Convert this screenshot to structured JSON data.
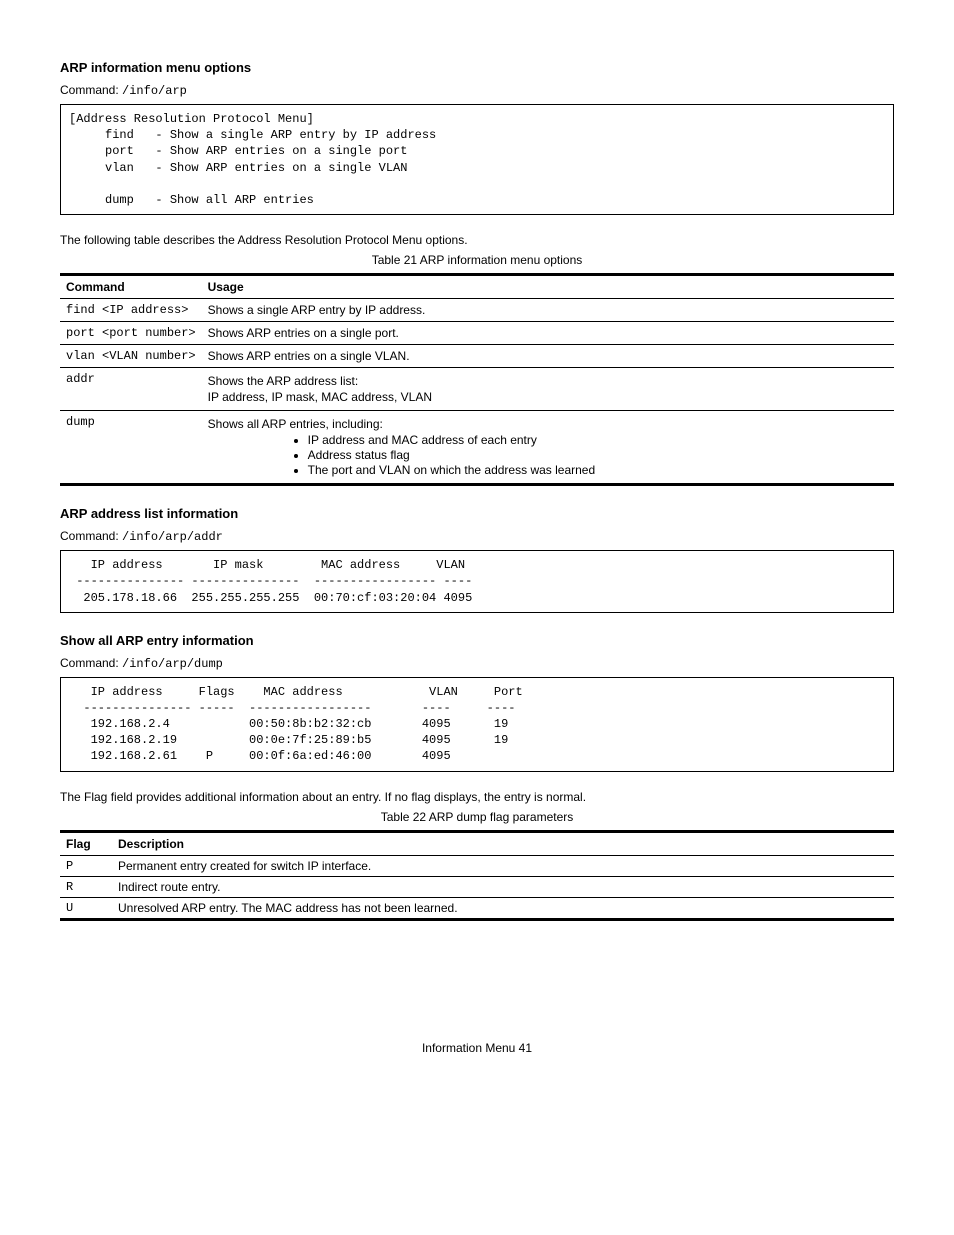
{
  "arp_menu": {
    "heading": "ARP information menu options",
    "intro_prefix": "Command:",
    "intro_code": "/info/arp",
    "code_block": "[Address Resolution Protocol Menu]\n     find   - Show a single ARP entry by IP address\n     port   - Show ARP entries on a single port\n     vlan   - Show ARP entries on a single VLAN\n\n     dump   - Show all ARP entries",
    "table_intro": "The following table describes the Address Resolution Protocol Menu options.",
    "table_caption": "Table 21 ARP information menu options",
    "col_command": "Command",
    "col_usage": "Usage",
    "rows": [
      {
        "cmd": "find",
        "arg": "<IP address>",
        "usage": "Shows a single ARP entry by IP address."
      },
      {
        "cmd": "port",
        "arg": "<port number>",
        "usage": "Shows ARP entries on a single port."
      },
      {
        "cmd": "vlan",
        "arg": "<VLAN number>",
        "usage": "Shows ARP entries on a single VLAN."
      },
      {
        "cmd": "addr",
        "arg": "",
        "usage_line": "Shows the ARP address list:",
        "bullets": [
          "IP address",
          "IP mask",
          "MAC address",
          "VLAN"
        ]
      },
      {
        "cmd": "dump",
        "arg": "",
        "usage_line": "Shows all ARP entries, including:",
        "bullets": [
          "IP address and MAC address of each entry",
          "Address status flag",
          "The port and VLAN on which the address was learned"
        ]
      }
    ]
  },
  "addr_section": {
    "heading": "ARP address list information",
    "intro_prefix": "Command:",
    "intro_code": "/info/arp/addr",
    "code_block": "   IP address       IP mask        MAC address     VLAN\n --------------- ---------------  ----------------- ----\n  205.178.18.66  255.255.255.255  00:70:cf:03:20:04 4095"
  },
  "dump_section": {
    "heading": "Show all ARP entry information",
    "intro_prefix": "Command:",
    "intro_code": "/info/arp/dump",
    "code_block": "   IP address     Flags    MAC address            VLAN     Port\n  --------------- -----  -----------------       ----     ----\n   192.168.2.4           00:50:8b:b2:32:cb       4095      19\n   192.168.2.19          00:0e:7f:25:89:b5       4095      19\n   192.168.2.61    P     00:0f:6a:ed:46:00       4095",
    "flag_intro": "The Flag field provides additional information about an entry. If no flag displays, the entry is normal.",
    "flag_caption": "Table 22 ARP dump flag parameters",
    "col_flag": "Flag",
    "col_desc": "Description",
    "flags": [
      {
        "flag": "P",
        "desc": "Permanent entry created for switch IP interface."
      },
      {
        "flag": "R",
        "desc": "Indirect route entry."
      },
      {
        "flag": "U",
        "desc": "Unresolved ARP entry. The MAC address has not been learned."
      }
    ]
  },
  "footer": {
    "text": "Information Menu  41"
  }
}
